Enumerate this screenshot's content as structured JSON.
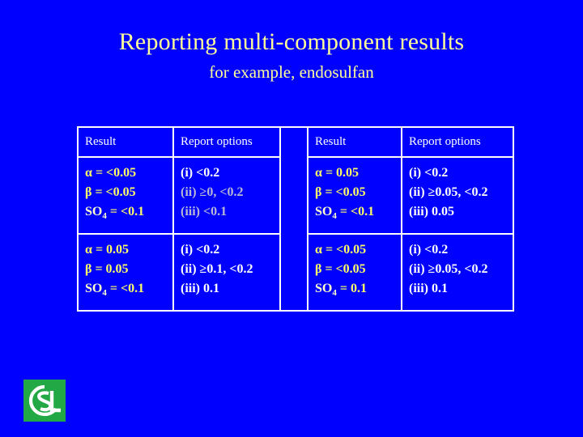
{
  "slide": {
    "background_color": "#0000FF",
    "title": "Reporting multi-component results",
    "subtitle": "for example, endosulfan"
  },
  "colors": {
    "title_yellow": "#FFFF99",
    "result_yellow": "#FFFF66",
    "option_white": "#FFFFFF",
    "option_dim": "#B9B9D6",
    "border_white": "#FFFFFF",
    "logo_green": "#22A844"
  },
  "table": {
    "headers": {
      "left_result": "Result",
      "left_options": "Report options",
      "spacer": "",
      "right_result": "Result",
      "right_options": "Report options"
    },
    "rows": [
      {
        "left_result": {
          "alpha": {
            "symbol": "α",
            "relation": "= <0.05"
          },
          "beta": {
            "symbol": "β",
            "relation": "= <0.05"
          },
          "so4": {
            "symbol": "SO",
            "subscript": "4",
            "relation": "= <0.1"
          }
        },
        "left_options": [
          {
            "text": "(i) <0.2",
            "style": "bright"
          },
          {
            "text": "(ii) ≥0, <0.2",
            "style": "dim"
          },
          {
            "text": "(iii) <0.1",
            "style": "dim"
          }
        ],
        "right_result": {
          "alpha": {
            "symbol": "α",
            "relation": "= 0.05"
          },
          "beta": {
            "symbol": "β",
            "relation": "= <0.05"
          },
          "so4": {
            "symbol": "SO",
            "subscript": "4",
            "relation": "= <0.1"
          }
        },
        "right_options": [
          {
            "text": "(i) <0.2",
            "style": "bright"
          },
          {
            "text": "(ii) ≥0.05, <0.2",
            "style": "bright"
          },
          {
            "text": "(iii) 0.05",
            "style": "bright"
          }
        ]
      },
      {
        "left_result": {
          "alpha": {
            "symbol": "α",
            "relation": "= 0.05"
          },
          "beta": {
            "symbol": "β",
            "relation": "= 0.05"
          },
          "so4": {
            "symbol": "SO",
            "subscript": "4",
            "relation": "= <0.1"
          }
        },
        "left_options": [
          {
            "text": "(i) <0.2",
            "style": "bright"
          },
          {
            "text": "(ii) ≥0.1, <0.2",
            "style": "bright"
          },
          {
            "text": "(iii) 0.1",
            "style": "bright"
          }
        ],
        "right_result": {
          "alpha": {
            "symbol": "α",
            "relation": "= <0.05"
          },
          "beta": {
            "symbol": "β",
            "relation": "= <0.05"
          },
          "so4": {
            "symbol": "SO",
            "subscript": "4",
            "relation": "= 0.1"
          }
        },
        "right_options": [
          {
            "text": "(i) <0.2",
            "style": "bright"
          },
          {
            "text": "(ii) ≥0.05, <0.2",
            "style": "bright"
          },
          {
            "text": "(iii) 0.1",
            "style": "bright"
          }
        ]
      }
    ]
  },
  "logo": {
    "name": "csl-logo",
    "letters": "CSL"
  }
}
